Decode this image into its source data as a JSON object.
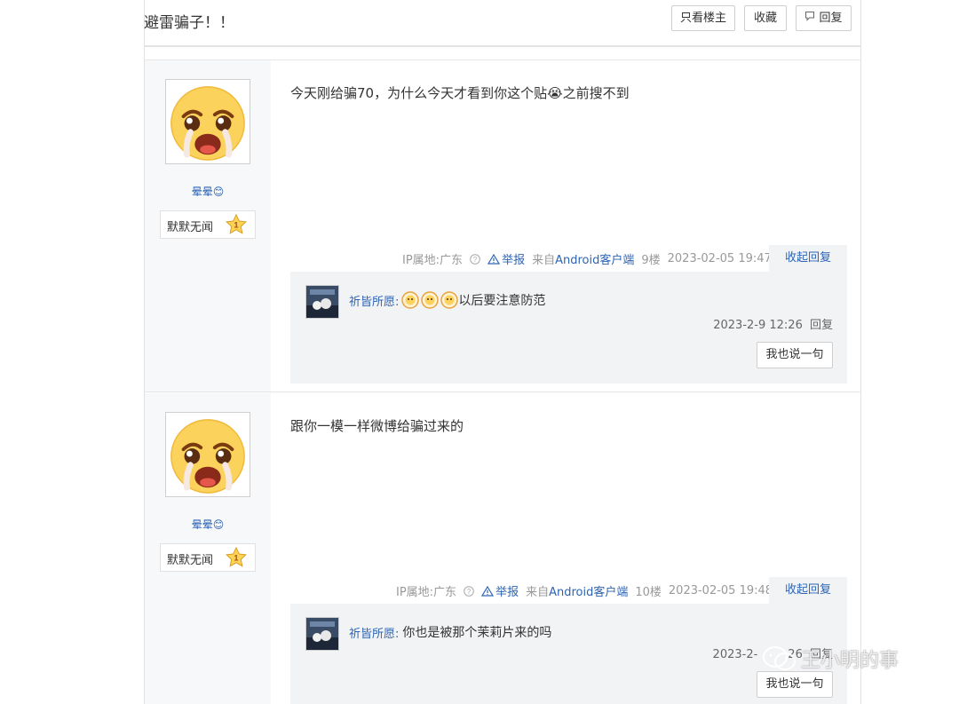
{
  "header": {
    "title": "避雷骗子！！",
    "buttons": {
      "only_op": "只看楼主",
      "favorite": "收藏",
      "reply": "回复"
    }
  },
  "posts": [
    {
      "user_name": "晕晕😊",
      "badge_label": "默默无闻",
      "badge_level": "1",
      "content": "今天刚给骗70，为什么今天才看到你这个贴😭之前搜不到",
      "meta": {
        "ip": "IP属地:广东",
        "report": "举报",
        "client_prefix": "来自",
        "client": "Android客户端",
        "floor": "9楼",
        "time": "2023-02-05 19:47",
        "collapse": "收起回复"
      },
      "reply": {
        "user": "祈皆所愿:",
        "text": "以后要注意防范",
        "time": "2023-2-9 12:26",
        "reply_label": "回复",
        "say_button": "我也说一句"
      }
    },
    {
      "user_name": "晕晕😊",
      "badge_label": "默默无闻",
      "badge_level": "1",
      "content": "跟你一模一样微博给骗过来的",
      "meta": {
        "ip": "IP属地:广东",
        "report": "举报",
        "client_prefix": "来自",
        "client": "Android客户端",
        "floor": "10楼",
        "time": "2023-02-05 19:48",
        "collapse": "收起回复"
      },
      "reply": {
        "user": "祈皆所愿:",
        "text": "你也是被那个茉莉片来的吗",
        "time": "2023-2-",
        "time_end": "26",
        "reply_label": "回复",
        "say_button": "我也说一句"
      }
    }
  ],
  "watermark": "王小明的事",
  "colors": {
    "link": "#2d64b3",
    "sidebar_bg": "#f7f8fa",
    "reply_bg": "#f2f3f5",
    "border": "#cfcfcf"
  }
}
